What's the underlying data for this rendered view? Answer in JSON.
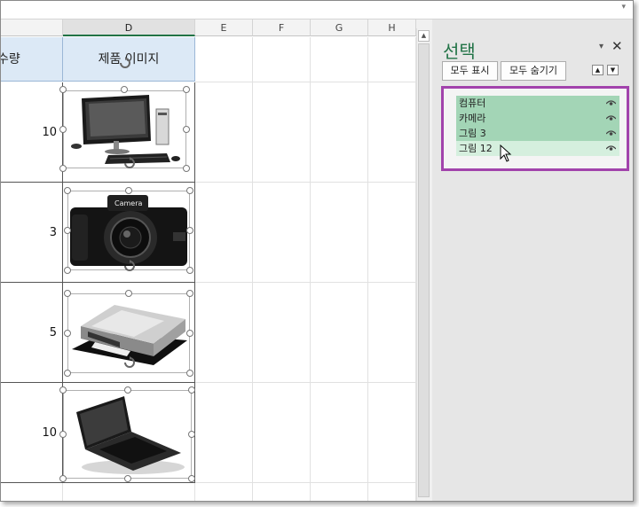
{
  "columns": [
    "D",
    "E",
    "F",
    "G",
    "H"
  ],
  "header": {
    "qty_partial": "수량",
    "image_label": "제품 이미지"
  },
  "rows": [
    {
      "qty": "10",
      "image": "computer"
    },
    {
      "qty": "3",
      "image": "camera"
    },
    {
      "qty": "5",
      "image": "printer"
    },
    {
      "qty": "10",
      "image": "laptop"
    }
  ],
  "camera_brand": "Camera",
  "pane": {
    "title": "선택",
    "show_all": "모두 표시",
    "hide_all": "모두 숨기기",
    "items": [
      {
        "label": "컴퓨터",
        "state": "selected"
      },
      {
        "label": "카메라",
        "state": "selected"
      },
      {
        "label": "그림 3",
        "state": "selected"
      },
      {
        "label": "그림 12",
        "state": "hover"
      }
    ]
  },
  "colors": {
    "accent_green": "#217346",
    "highlight": "#a243ac",
    "selected_item": "#a3d5b6",
    "header_fill": "#dce9f6"
  }
}
